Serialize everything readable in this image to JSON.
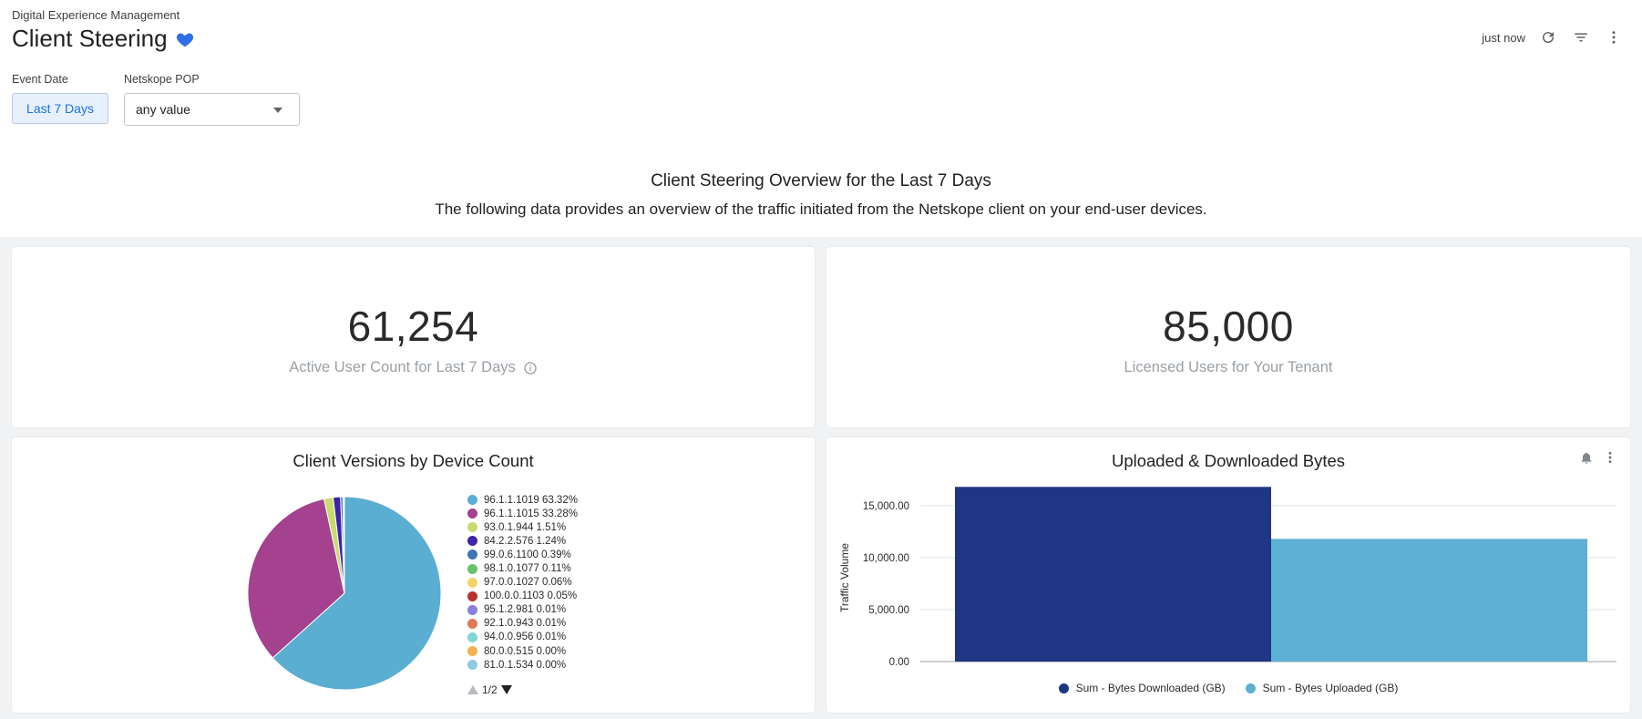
{
  "header": {
    "breadcrumb": "Digital Experience Management",
    "title": "Client Steering",
    "updated": "just now"
  },
  "filters": {
    "event_date": {
      "label": "Event Date",
      "value": "Last 7 Days"
    },
    "netskope_pop": {
      "label": "Netskope POP",
      "value": "any value"
    }
  },
  "overview": {
    "title": "Client Steering Overview for the Last 7 Days",
    "subtitle": "The following data provides an overview of the traffic initiated from the Netskope client on your end-user devices."
  },
  "kpis": [
    {
      "value": "61,254",
      "label": "Active User Count for Last 7 Days"
    },
    {
      "value": "85,000",
      "label": "Licensed Users for Your Tenant"
    }
  ],
  "pager": "1/2",
  "colors": {
    "accent": "#1a73e8",
    "heart": "#2f6fe4",
    "downloaded": "#1e3683",
    "uploaded": "#5db0d3"
  },
  "chart_data": [
    {
      "type": "pie",
      "title": "Client Versions by Device Count",
      "slices": [
        {
          "label": "96.1.1.1019",
          "value": 63.32,
          "pct": "63.32%",
          "color": "#5aaed2"
        },
        {
          "label": "96.1.1.1015",
          "value": 33.28,
          "pct": "33.28%",
          "color": "#a4428f"
        },
        {
          "label": "93.0.1.944",
          "value": 1.51,
          "pct": "1.51%",
          "color": "#c8dc6c"
        },
        {
          "label": "84.2.2.576",
          "value": 1.24,
          "pct": "1.24%",
          "color": "#3d23a7"
        },
        {
          "label": "99.0.6.1100",
          "value": 0.39,
          "pct": "0.39%",
          "color": "#4273b3"
        },
        {
          "label": "98.1.0.1077",
          "value": 0.11,
          "pct": "0.11%",
          "color": "#6cc26c"
        },
        {
          "label": "97.0.0.1027",
          "value": 0.06,
          "pct": "0.06%",
          "color": "#f6d36a"
        },
        {
          "label": "100.0.0.1103",
          "value": 0.05,
          "pct": "0.05%",
          "color": "#b7322f"
        },
        {
          "label": "95.1.2.981",
          "value": 0.01,
          "pct": "0.01%",
          "color": "#8b7fe0"
        },
        {
          "label": "92.1.0.943",
          "value": 0.01,
          "pct": "0.01%",
          "color": "#df7a55"
        },
        {
          "label": "94.0.0.956",
          "value": 0.01,
          "pct": "0.01%",
          "color": "#82d6d6"
        },
        {
          "label": "80.0.0.515",
          "value": 0.0,
          "pct": "0.00%",
          "color": "#f5b24f"
        },
        {
          "label": "81.0.1.534",
          "value": 0.0,
          "pct": "0.00%",
          "color": "#8fc9e4"
        }
      ]
    },
    {
      "type": "bar",
      "title": "Uploaded & Downloaded Bytes",
      "ylabel": "Traffic Volume",
      "ylim": [
        0,
        17000
      ],
      "yticks": [
        "0.00",
        "5,000.00",
        "10,000.00",
        "15,000.00"
      ],
      "ytick_values": [
        0,
        5000,
        10000,
        15000
      ],
      "series": [
        {
          "name": "Sum - Bytes Downloaded (GB)",
          "value": 16800,
          "color": "#1e3683"
        },
        {
          "name": "Sum - Bytes Uploaded (GB)",
          "value": 11800,
          "color": "#5db0d3"
        }
      ],
      "grid": true,
      "legend": "bottom"
    }
  ]
}
